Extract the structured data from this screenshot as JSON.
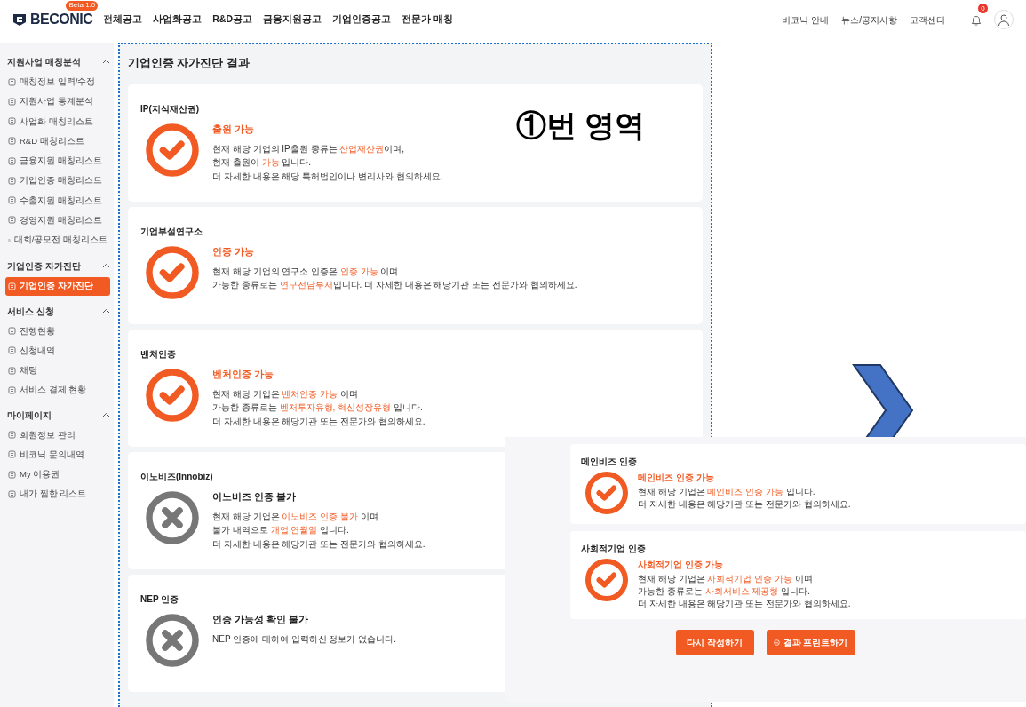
{
  "header": {
    "logo": "BECONIC",
    "logo_badge": "Beta 1.0",
    "nav": [
      "전체공고",
      "사업화공고",
      "R&D공고",
      "금융지원공고",
      "기업인증공고",
      "전문가 매칭"
    ],
    "links": [
      "비코닉 안내",
      "뉴스/공지사항",
      "고객센터"
    ],
    "notification_count": "0"
  },
  "sidebar": [
    {
      "title": "지원사업 매칭분석",
      "expanded": true,
      "items": [
        {
          "label": "매칭정보 입력/수정",
          "selected": false
        },
        {
          "label": "지원사업 통계분석",
          "selected": false
        },
        {
          "label": "사업화 매칭리스트",
          "selected": false
        },
        {
          "label": "R&D 매칭리스트",
          "selected": false
        },
        {
          "label": "금융지원 매칭리스트",
          "selected": false
        },
        {
          "label": "기업인증 매칭리스트",
          "selected": false
        },
        {
          "label": "수출지원 매칭리스트",
          "selected": false
        },
        {
          "label": "경영지원 매칭리스트",
          "selected": false
        },
        {
          "label": "대회/공모전 매칭리스트",
          "selected": false
        }
      ]
    },
    {
      "title": "기업인증 자가진단",
      "expanded": true,
      "items": [
        {
          "label": "기업인증 자가진단",
          "selected": true
        }
      ]
    },
    {
      "title": "서비스 신청",
      "expanded": true,
      "items": [
        {
          "label": "진행현황",
          "selected": false
        },
        {
          "label": "신청내역",
          "selected": false
        },
        {
          "label": "채팅",
          "selected": false
        },
        {
          "label": "서비스 결제 현황",
          "selected": false
        }
      ]
    },
    {
      "title": "마이페이지",
      "expanded": true,
      "items": [
        {
          "label": "회원정보 관리",
          "selected": false
        },
        {
          "label": "비코닉 문의내역",
          "selected": false
        },
        {
          "label": "My 이용권",
          "selected": false
        },
        {
          "label": "내가 찜한 리스트",
          "selected": false
        }
      ]
    }
  ],
  "page_title": "기업인증 자가진단 결과",
  "annotation": "①번 영역",
  "results": [
    {
      "title": "IP(지식재산권)",
      "kind": "pass",
      "status": "출원 가능",
      "lines": [
        "현재 해당 기업의 IP출원 종류는 **산업재산권**이며,",
        "현재 출원이 **가능** 입니다.",
        "더 자세한 내용은 해당 특허법인이나 변리사와 협의하세요."
      ]
    },
    {
      "title": "기업부설연구소",
      "kind": "pass",
      "status": "인증 가능",
      "lines": [
        "현재 해당 기업의 연구소 인증은 **인증 가능** 이며",
        "가능한 종류로는 **연구전담부서**입니다. 더 자세한 내용은 해당기관 또는 전문가와 협의하세요."
      ]
    },
    {
      "title": "벤처인증",
      "kind": "pass",
      "status": "벤처인증 가능",
      "lines": [
        "현재 해당 기업은 **벤처인증 가능** 이며",
        "가능한 종류로는 **벤처투자유형, 혁신성장유형** 입니다.",
        "더 자세한 내용은 해당기관 또는 전문가와 협의하세요."
      ]
    },
    {
      "title": "이노비즈(Innobiz)",
      "kind": "fail",
      "status": "이노비즈 인증 불가",
      "lines": [
        "현재 해당 기업은 **이노비즈 인증 불가** 이며",
        "불가 내역으로 **개업 연월일** 입니다.",
        "더 자세한 내용은 해당기관 또는 전문가와 협의하세요."
      ]
    },
    {
      "title": "NEP 인증",
      "kind": "fail",
      "status": "인증 가능성 확인 불가",
      "lines": [
        "NEP 인증에 대하여 입력하신 정보가 없습니다."
      ]
    }
  ],
  "continued": {
    "results": [
      {
        "title": "메인비즈 인증",
        "kind": "pass",
        "status": "메인비즈 인증 가능",
        "lines": [
          "현재 해당 기업은 **메인비즈 인증 가능** 입니다.",
          "더 자세한 내용은 해당기관 또는 전문가와 협의하세요."
        ]
      },
      {
        "title": "사회적기업 인증",
        "kind": "pass",
        "status": "사회적기업 인증 가능",
        "lines": [
          "현재 해당 기업은 **사회적기업 인증 가능** 이며",
          "가능한 종류로는 **사회서비스 제공형** 입니다.",
          "더 자세한 내용은 해당기관 또는 전문가와 협의하세요."
        ]
      }
    ],
    "buttons": [
      {
        "label": "다시 작성하기",
        "kind": "plain"
      },
      {
        "label": "결과 프린트하기",
        "kind": "print"
      }
    ]
  }
}
